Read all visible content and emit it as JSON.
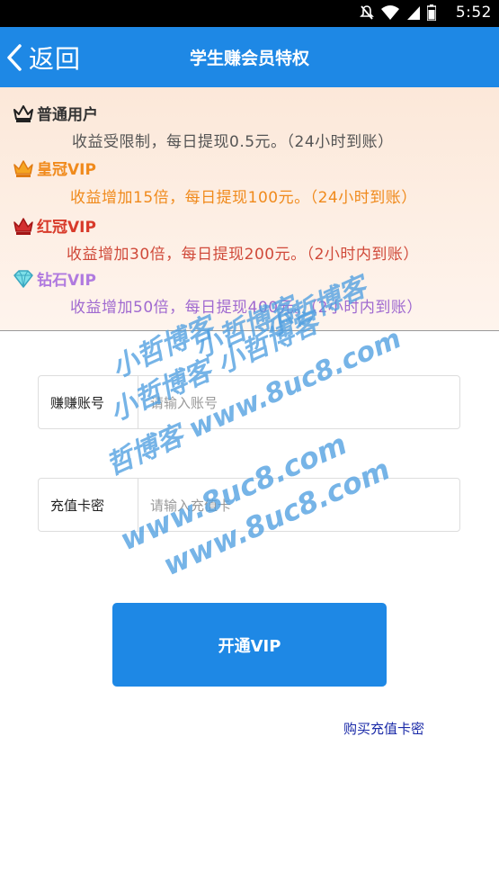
{
  "status_bar": {
    "time": "5:52"
  },
  "header": {
    "back_label": "返回",
    "title": "学生赚会员特权"
  },
  "tiers": [
    {
      "name": "普通用户",
      "description": "收益受限制，每日提现0.5元。（24小时到账）",
      "icon": "crown-icon",
      "title_color": "#333333",
      "desc_color": "#555555"
    },
    {
      "name": "皇冠VIP",
      "description": "收益增加15倍，每日提现100元。（24小时到账）",
      "icon": "crown-icon",
      "title_color": "#f08a1c",
      "desc_color": "#f08a1c"
    },
    {
      "name": "红冠VIP",
      "description": "收益增加30倍，每日提现200元。（2小时内到账）",
      "icon": "crown-icon",
      "title_color": "#d83a2a",
      "desc_color": "#d04a3a"
    },
    {
      "name": "钻石VIP",
      "description": "收益增加50倍，每日提现400元。（2小时内到账）",
      "icon": "diamond-icon",
      "title_color": "#b07adf",
      "desc_color": "#a06ad0"
    }
  ],
  "form": {
    "account": {
      "label": "赚赚账号",
      "placeholder": "请输入账号",
      "value": ""
    },
    "card": {
      "label": "充值卡密",
      "placeholder": "请输入充值卡",
      "value": ""
    }
  },
  "submit_label": "开通VIP",
  "buy_link": "购买充值卡密",
  "watermark": {
    "lines": [
      "小哲博客",
      "小哲博客",
      "小哲博客",
      "小哲博客 小哲博客",
      "哲博客 www.8uc8.com",
      "www.8uc8.com",
      "www.8uc8.com"
    ]
  },
  "colors": {
    "primary": "#1e88e5",
    "link": "#1a2aa8",
    "tier_bg": "#fce8d9"
  }
}
